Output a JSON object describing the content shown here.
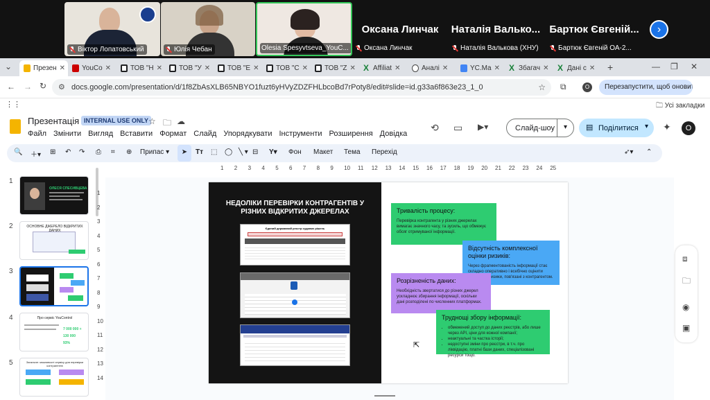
{
  "video_call": {
    "participants": [
      {
        "name": "Віктор Лопатовський",
        "muted": true
      },
      {
        "name": "Юлія Чебан",
        "muted": true
      },
      {
        "name": "Olesia Spesyvtseva_YouC...",
        "muted": false
      },
      {
        "name": "Оксана Линчак",
        "muted": true
      },
      {
        "name": "Наталія Валькова (ХНУ)",
        "muted": true
      },
      {
        "name": "Бартюк Євгеній ОА-2...",
        "muted": true
      }
    ],
    "name_only_tiles": [
      "Оксана Линчак",
      "Наталія Валько...",
      "Бартюк Євгеній..."
    ]
  },
  "browser": {
    "tabs": [
      {
        "label": "Презен",
        "icon": "slides",
        "active": true
      },
      {
        "label": "YouCo",
        "icon": "yt"
      },
      {
        "label": "ТОВ \"Н",
        "icon": "doc"
      },
      {
        "label": "ТОВ \"У",
        "icon": "doc"
      },
      {
        "label": "ТОВ \"Е",
        "icon": "doc"
      },
      {
        "label": "ТОВ \"С",
        "icon": "doc"
      },
      {
        "label": "ТОВ \"Z",
        "icon": "doc"
      },
      {
        "label": "Affiliat",
        "icon": "xl"
      },
      {
        "label": "Аналі",
        "icon": "cc"
      },
      {
        "label": "YC.Ma",
        "icon": "yc"
      },
      {
        "label": "Збагач",
        "icon": "xl"
      },
      {
        "label": "Дані с",
        "icon": "xl"
      }
    ],
    "url": "docs.google.com/presentation/d/1f8ZbAsXLB65NBYO1fuzt6yHVyZDZFHLbcoBd7rPoty8/edit#slide=id.g33a6f863e23_1_0",
    "relaunch_label": "Перезапустити, щоб оновити дані",
    "profile_initial": "O",
    "bookmarks_label": "Усі закладки"
  },
  "slides_app": {
    "doc_title": "Презентація",
    "badge": "INTERNAL USE ONLY",
    "menus": [
      "Файл",
      "Змінити",
      "Вигляд",
      "Вставити",
      "Формат",
      "Слайд",
      "Упорядкувати",
      "Інструменти",
      "Розширення",
      "Довідка"
    ],
    "slideshow_label": "Слайд-шоу",
    "share_label": "Поділитися",
    "avatar_initial": "O",
    "toolbar": {
      "fit": "Припас",
      "bg": "Фон",
      "layout": "Макет",
      "theme": "Тема",
      "transition": "Перехід"
    },
    "ruler_ticks": [
      "1",
      "2",
      "3",
      "4",
      "5",
      "6",
      "7",
      "8",
      "9",
      "10",
      "11",
      "12",
      "13",
      "14",
      "15",
      "16",
      "17",
      "18",
      "19",
      "20",
      "21",
      "22",
      "23",
      "24",
      "25"
    ],
    "vruler_ticks": [
      "1",
      "2",
      "3",
      "4",
      "5",
      "6",
      "7",
      "8",
      "9",
      "10",
      "11",
      "12",
      "13",
      "14"
    ],
    "slide_numbers": [
      "1",
      "2",
      "3",
      "4",
      "5"
    ],
    "thumbs": {
      "t1_name": "ОЛЕСЯ СПЕСИВЦЕВА",
      "t2_title": "ОСНОВНЕ ДЖЕРЕЛО ВІДКРИТИХ ДАНИХ",
      "t4_title": "Про сервіс YouControl",
      "t4_stats": [
        "7 000 000 +",
        "130 000",
        "93%"
      ],
      "t5_title": "Загальне: можливості сервісу для перевірки контрагентів"
    },
    "current_slide": {
      "title": "НЕДОЛІКИ ПЕРЕВІРКИ КОНТРАГЕНТІВ У РІЗНИХ ВІДКРИТИХ ДЖЕРЕЛАХ",
      "screenshot1_title": "Єдиний державний реєстр судових рішень",
      "boxes": [
        {
          "title": "Тривалість процесу:",
          "body": "Перевірка контрагента у різних джерелах вимагає значного часу, та зусиль, що обмежує обсяг отримуваної інформації.",
          "color": "#2ecc71"
        },
        {
          "title": "Відсутність комплексної оцінки ризиків:",
          "body": "Через фрагментованість інформації стає складно оперативно і всебічно оцінити потенційні ризики, пов'язані з контрагентом.",
          "color": "#4aa8f5"
        },
        {
          "title": "Розрізненість даних:",
          "body": "Необхідність звертатися до різних джерел ускладнює збирання інформації, оскільки дані розподілені по численних платформах.",
          "color": "#b98af0"
        },
        {
          "title": "Труднощі збору інформації:",
          "bullets": [
            "обмежений доступ до даних реєстрів, або лише через API, ціни для кожної компанії;",
            "неактуальні та частка історії;",
            "недоступні зміни про реєстри, в т.ч. про ліквідацію, платні бази даних, спеціалізовані ресурси тощо."
          ],
          "color": "#2ecc71"
        }
      ]
    }
  }
}
